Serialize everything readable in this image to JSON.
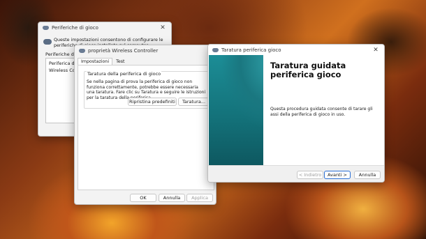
{
  "window1": {
    "title": "Periferiche di gioco",
    "description": "Queste impostazioni consentono di configurare le periferiche di gioco installate sul computer.",
    "list_label": "Periferiche di gio",
    "list_items": [
      "Periferica di gio",
      "Wireless Contro"
    ],
    "close_glyph": "✕"
  },
  "window2": {
    "title": "proprietà Wireless Controller",
    "tabs": [
      "Impostazioni",
      "Test"
    ],
    "group_title": "Taratura della periferica di gioco",
    "group_text": "Se nella pagina di prova la periferica di gioco non funziona correttamente, potrebbe essere necessaria una taratura. Fare clic su Taratura e seguire le istruzioni per la taratura della periferica.",
    "reset_button": "Ripristina predefiniti",
    "calibrate_button": "Taratura...",
    "ok_button": "OK",
    "cancel_button": "Annulla",
    "apply_button": "Applica",
    "close_glyph": "✕"
  },
  "window3": {
    "title": "Taratura periferica gioco",
    "heading": "Taratura guidata periferica gioco",
    "body": "Questa procedura guidata consente di tarare gli assi della periferica di gioco in uso.",
    "back_button": "< Indietro",
    "next_button": "Avanti >",
    "cancel_button": "Annulla",
    "close_glyph": "✕"
  },
  "icons": {
    "gamepad": "gamepad-icon",
    "close": "close-icon"
  },
  "colors": {
    "accent": "#2a6fd6",
    "wizard_teal": "#1c8d96"
  }
}
